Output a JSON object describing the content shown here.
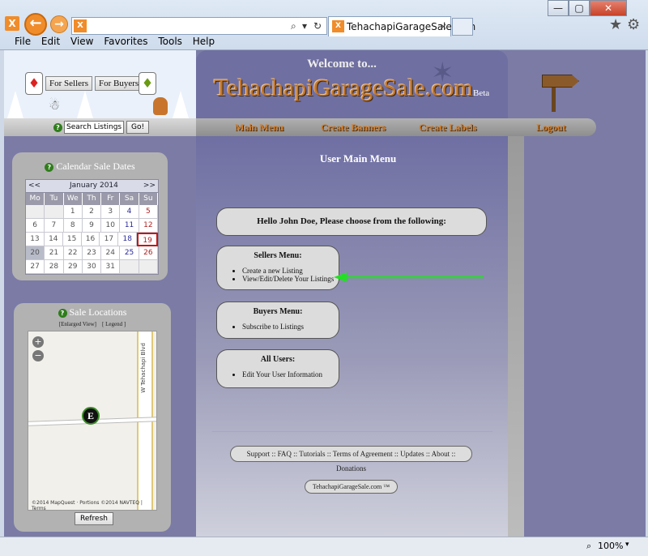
{
  "browser": {
    "tab_title": "TehachapiGarageSale.com",
    "menus": [
      "File",
      "Edit",
      "View",
      "Favorites",
      "Tools",
      "Help"
    ],
    "min_glyph": "—",
    "max_glyph": "▢",
    "close_glyph": "✕",
    "back_glyph": "←",
    "forward_glyph": "→",
    "logo_glyph": "X",
    "search_glyph": "⌕",
    "dropdown_glyph": "▾",
    "refresh_glyph": "↻",
    "tab_close_glyph": "×",
    "home_glyph": "★",
    "settings_glyph": "⚙",
    "zoom": "100%"
  },
  "banner": {
    "for_sellers": "For Sellers",
    "for_buyers": "For Buyers",
    "seller_flame_glyph": "♦",
    "buyer_flame_glyph": "♦",
    "snowman_glyph": "☃"
  },
  "search": {
    "selected": "Search Listings",
    "go": "Go!",
    "help_glyph": "?"
  },
  "header": {
    "welcome": "Welcome to...",
    "title": "TehachapiGarageSale.com",
    "beta": "Beta",
    "ornament_glyph": "✶"
  },
  "nav": {
    "main_menu": "Main Menu",
    "create_banners": "Create Banners",
    "create_labels": "Create Labels",
    "logout": "Logout"
  },
  "calendar": {
    "title": "Calendar Sale Dates",
    "prev": "<<",
    "next": ">>",
    "month": "January 2014",
    "weekdays": [
      "Mo",
      "Tu",
      "We",
      "Th",
      "Fr",
      "Sa",
      "Su"
    ],
    "weeks": [
      [
        "",
        "",
        "1",
        "2",
        "3",
        "4",
        "5"
      ],
      [
        "6",
        "7",
        "8",
        "9",
        "10",
        "11",
        "12"
      ],
      [
        "13",
        "14",
        "15",
        "16",
        "17",
        "18",
        "19"
      ],
      [
        "20",
        "21",
        "22",
        "23",
        "24",
        "25",
        "26"
      ],
      [
        "27",
        "28",
        "29",
        "30",
        "31",
        "",
        ""
      ]
    ]
  },
  "locations": {
    "title": "Sale Locations",
    "enlarged": "[Enlarged View]",
    "legend": "[ Legend ]",
    "road": "W Tehachapi Blvd",
    "marker": "E",
    "zoom_in": "+",
    "zoom_out": "−",
    "credit": "©2014 MapQuest · Portions ©2014 NAVTEQ | Terms",
    "refresh": "Refresh"
  },
  "main": {
    "title": "User Main Menu",
    "greeting": "Hello John Doe, Please choose from the following:",
    "sellers": {
      "title": "Sellers Menu:",
      "items": [
        "Create a new Listing",
        "View/Edit/Delete Your Listings"
      ]
    },
    "buyers": {
      "title": "Buyers Menu:",
      "items": [
        "Subscribe to Listings"
      ]
    },
    "all_users": {
      "title": "All Users:",
      "items": [
        "Edit Your User Information"
      ]
    },
    "footer_links": "Support :: FAQ :: Tutorials :: Terms of Agreement :: Updates :: About :: Donations",
    "footer_brand": "TehachapiGarageSale.com ™"
  },
  "colors": {
    "page_purple": "#7b7ba6",
    "title_orange": "#c2762d",
    "arrow_green": "#22e022"
  }
}
